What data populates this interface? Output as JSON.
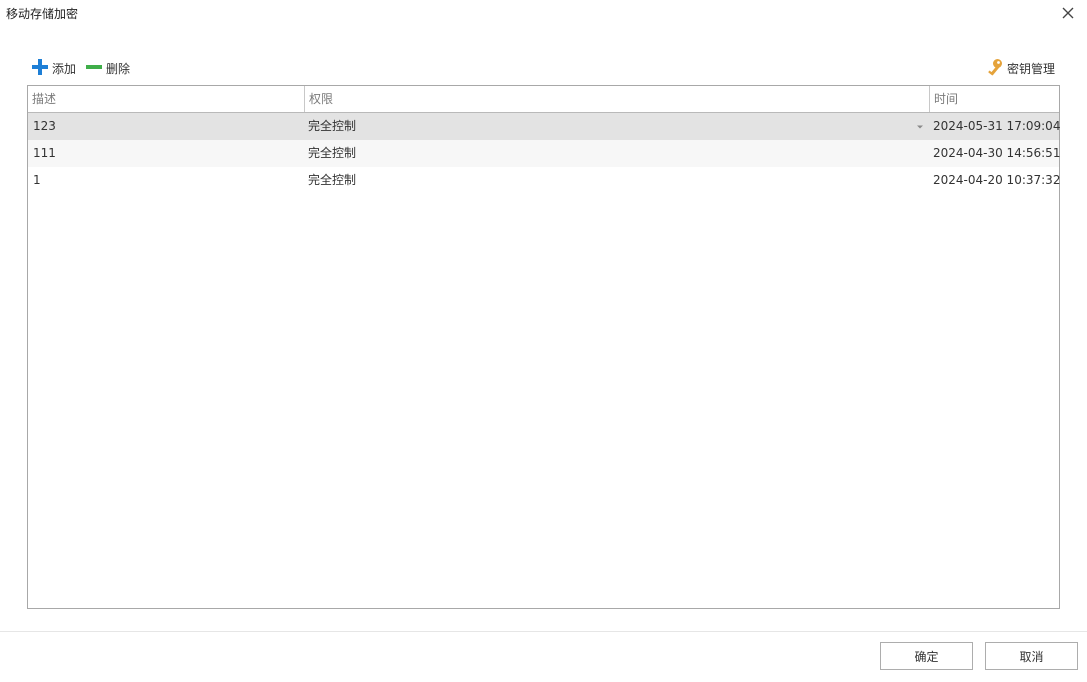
{
  "dialog": {
    "title": "移动存储加密"
  },
  "toolbar": {
    "add_label": "添加",
    "delete_label": "删除",
    "key_manage_label": "密钥管理",
    "add_icon": "plus-icon",
    "delete_icon": "minus-icon",
    "key_icon": "key-icon",
    "add_color": "#1e7fd6",
    "delete_color": "#3fae49",
    "key_color": "#e5a33b"
  },
  "table": {
    "columns": [
      "描述",
      "权限",
      "时间"
    ],
    "rows": [
      {
        "description": "123",
        "permission": "完全控制",
        "time": "2024-05-31 17:09:04",
        "selected": true
      },
      {
        "description": "111",
        "permission": "完全控制",
        "time": "2024-04-30 14:56:51",
        "selected": false
      },
      {
        "description": "1",
        "permission": "完全控制",
        "time": "2024-04-20 10:37:32",
        "selected": false
      }
    ]
  },
  "footer": {
    "ok_label": "确定",
    "cancel_label": "取消"
  }
}
